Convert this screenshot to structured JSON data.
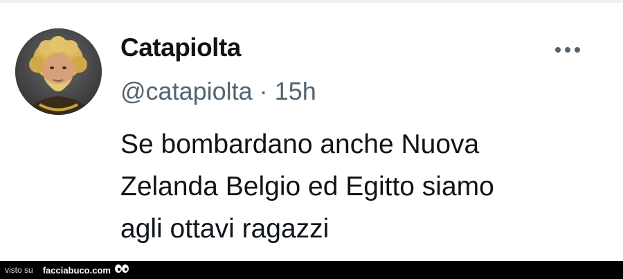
{
  "tweet": {
    "display_name": "Catapiolta",
    "handle": "@catapiolta",
    "separator": "·",
    "time": "15h",
    "text_lines": [
      "Se bombardano anche Nuova",
      "Zelanda Belgio ed Egitto siamo",
      "agli ottavi ragazzi"
    ],
    "more_icon": "ellipsis-horizontal-icon",
    "avatar_icon": "avatar-portrait"
  },
  "footer": {
    "prefix": "visto su",
    "site": "facciabuco.com",
    "logo_icon": "eyes-icon"
  },
  "colors": {
    "text_primary": "#0f1419",
    "text_secondary": "#536471",
    "footer_bg": "#000000"
  }
}
